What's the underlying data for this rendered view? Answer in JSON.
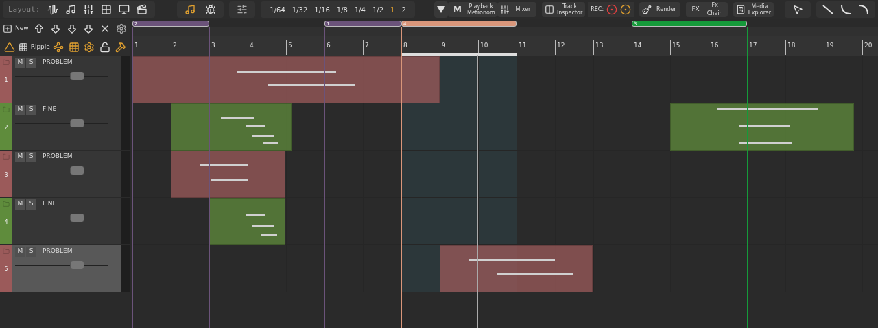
{
  "toolbar": {
    "layout_label": "Layout:",
    "grid_values": [
      {
        "label": "1/64",
        "selected": false
      },
      {
        "label": "1/32",
        "selected": false
      },
      {
        "label": "1/16",
        "selected": false
      },
      {
        "label": "1/8",
        "selected": false
      },
      {
        "label": "1/4",
        "selected": false
      },
      {
        "label": "1/2",
        "selected": false
      },
      {
        "label": "1",
        "selected": true
      },
      {
        "label": "2",
        "selected": false
      }
    ],
    "metronome": {
      "key": "M",
      "label": "Playback Metronom"
    },
    "mixer": "Mixer",
    "track_inspector": "Track Inspector",
    "rec_label": "REC:",
    "render": "Render",
    "fx_chain": {
      "badge": "FX",
      "label": "Fx Chain"
    },
    "media_explorer": "Media Explorer"
  },
  "tools": {
    "new": "New",
    "ripple": "Ripple"
  },
  "markers": [
    {
      "label": "2",
      "color": "#6b537a"
    },
    {
      "label": "1",
      "color": "#6b537a"
    },
    {
      "label": "4",
      "color": "#d9967a"
    },
    {
      "label": "3",
      "color": "#159a3a"
    }
  ],
  "ruler": [
    "1",
    "2",
    "3",
    "4",
    "5",
    "6",
    "7",
    "8",
    "9",
    "10",
    "11",
    "12",
    "13",
    "14",
    "15",
    "16",
    "17",
    "18",
    "19",
    "20"
  ],
  "tracks": [
    {
      "number": "1",
      "name": "PROBLEM",
      "mute": "M",
      "solo": "S",
      "color": "#9b5a5a",
      "level": 0.67,
      "selected": false
    },
    {
      "number": "2",
      "name": "FINE",
      "mute": "M",
      "solo": "S",
      "color": "#5f8c3c",
      "level": 0.67,
      "selected": false
    },
    {
      "number": "3",
      "name": "PROBLEM",
      "mute": "M",
      "solo": "S",
      "color": "#9b5a5a",
      "level": 0.67,
      "selected": false
    },
    {
      "number": "4",
      "name": "FINE",
      "mute": "M",
      "solo": "S",
      "color": "#5f8c3c",
      "level": 0.67,
      "selected": false
    },
    {
      "number": "5",
      "name": "PROBLEM",
      "mute": "M",
      "solo": "S",
      "color": "#9b5a5a",
      "level": 0.67,
      "selected": true
    }
  ]
}
